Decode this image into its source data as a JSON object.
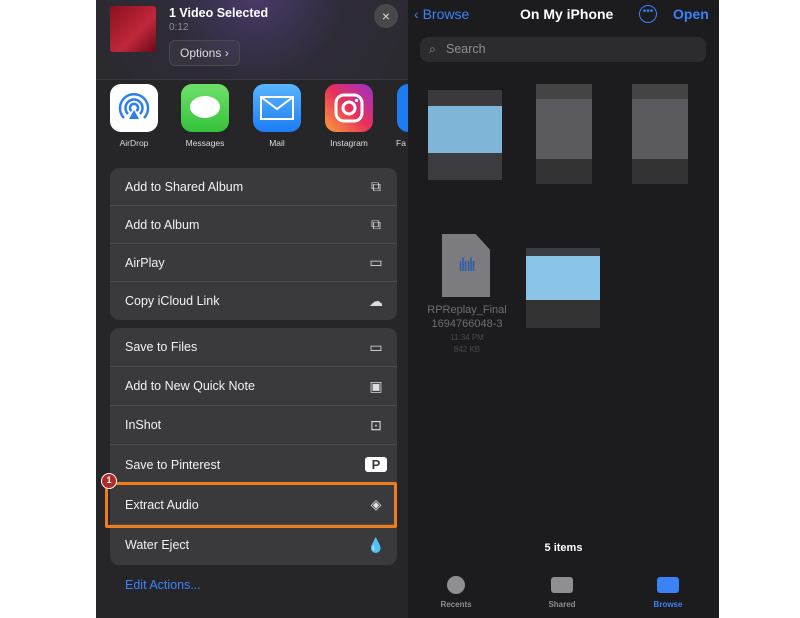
{
  "share_sheet": {
    "title": "1 Video Selected",
    "duration": "0:12",
    "options_label": "Options ›",
    "close_icon": "×",
    "apps": [
      {
        "label": "AirDrop"
      },
      {
        "label": "Messages"
      },
      {
        "label": "Mail"
      },
      {
        "label": "Instagram"
      },
      {
        "label": "Fa"
      }
    ],
    "group1": [
      {
        "label": "Add to Shared Album",
        "icon": "shared-album-icon"
      },
      {
        "label": "Add to Album",
        "icon": "add-album-icon"
      },
      {
        "label": "AirPlay",
        "icon": "airplay-icon"
      },
      {
        "label": "Copy iCloud Link",
        "icon": "icloud-link-icon"
      }
    ],
    "group2": [
      {
        "label": "Save to Files",
        "icon": "folder-icon"
      },
      {
        "label": "Add to New Quick Note",
        "icon": "quick-note-icon"
      },
      {
        "label": "InShot",
        "icon": "inshot-icon"
      },
      {
        "label": "Save to Pinterest",
        "icon": "pinterest-icon"
      },
      {
        "label": "Extract Audio",
        "icon": "layers-icon"
      },
      {
        "label": "Water Eject",
        "icon": "drop-icon"
      }
    ],
    "edit_actions": "Edit Actions...",
    "step_badge": "1",
    "highlight_color": "#f07d1a"
  },
  "files": {
    "back_label": "Browse",
    "title": "On My iPhone",
    "open_label": "Open",
    "search_placeholder": "Search",
    "audio_file": {
      "name_line1": "RPReplay_Final",
      "name_line2": "1694766048-3",
      "time": "11:34 PM",
      "size": "842 KB"
    },
    "count": "5 items",
    "tabs": [
      {
        "label": "Recents"
      },
      {
        "label": "Shared"
      },
      {
        "label": "Browse",
        "active": true
      }
    ],
    "accent": "#3b82f6"
  }
}
